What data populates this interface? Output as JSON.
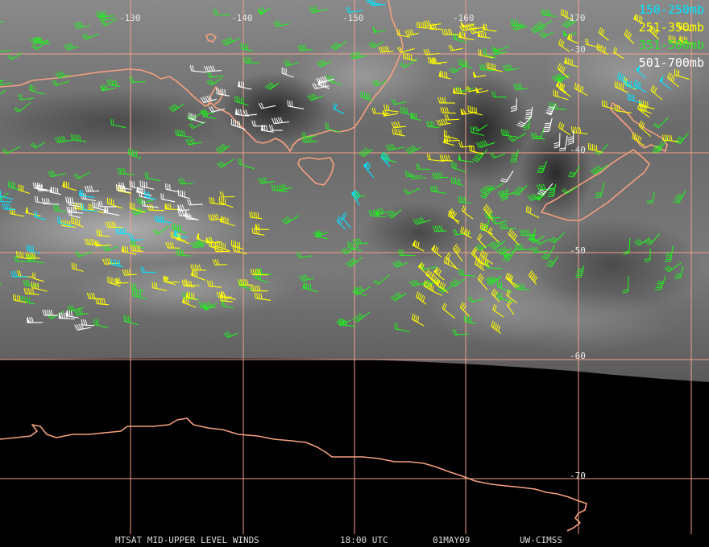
{
  "map": {
    "background_color": "#000000",
    "imagery_gray": "#6e6e6e",
    "grid_color": "#f0a088",
    "coast_color": "#f4a080",
    "lon_labels": [
      "-130",
      "-140",
      "-150",
      "-160",
      "-170"
    ],
    "lat_labels": [
      "-30",
      "-40",
      "-50",
      "-60",
      "-70"
    ]
  },
  "legend": [
    {
      "label": "150-250mb",
      "color": "#00e5ff"
    },
    {
      "label": "251-350mb",
      "color": "#ffff00"
    },
    {
      "label": "351-500mb",
      "color": "#22ee22"
    },
    {
      "label": "501-700mb",
      "color": "#ffffff"
    }
  ],
  "caption": {
    "product": "MTSAT MID-UPPER LEVEL WINDS",
    "time": "18:00 UTC",
    "date": "01MAY09",
    "source": "UW-CIMSS"
  }
}
